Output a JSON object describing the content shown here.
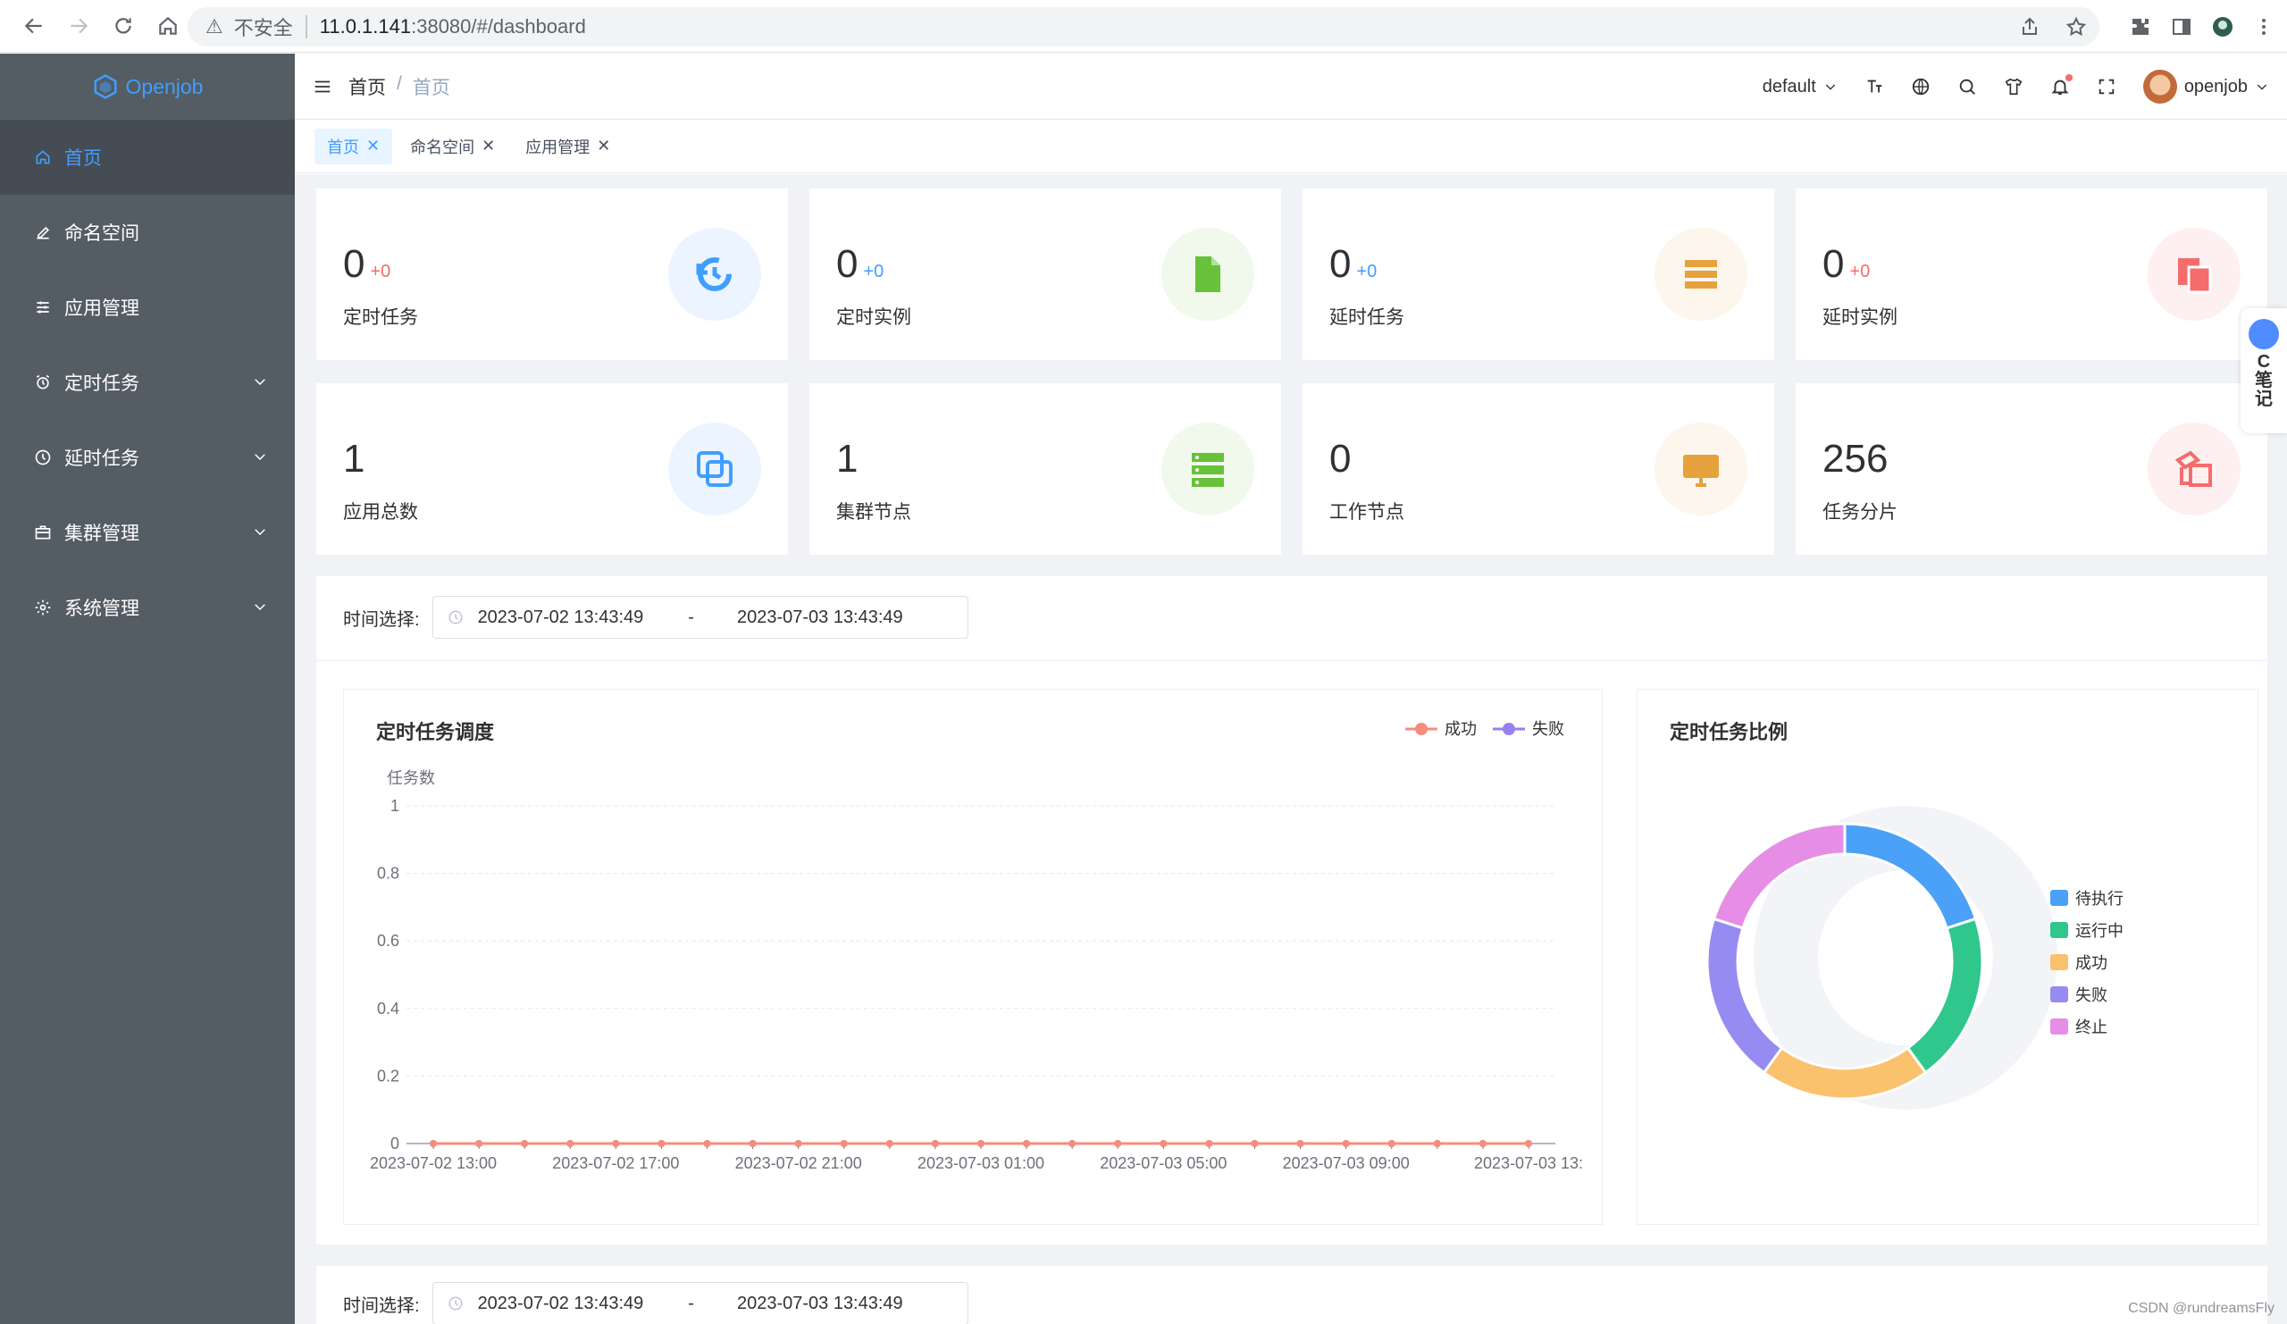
{
  "browser": {
    "insecure_label": "不安全",
    "url_host": "11.0.1.141",
    "url_rest": ":38080/#/dashboard"
  },
  "sidebar": {
    "logo_text": "Openjob",
    "items": [
      {
        "label": "首页",
        "icon": "home-icon",
        "active": true,
        "expandable": false
      },
      {
        "label": "命名空间",
        "icon": "edit-icon",
        "active": false,
        "expandable": false
      },
      {
        "label": "应用管理",
        "icon": "sliders-icon",
        "active": false,
        "expandable": false
      },
      {
        "label": "定时任务",
        "icon": "alarm-clock-icon",
        "active": false,
        "expandable": true
      },
      {
        "label": "延时任务",
        "icon": "clock-icon",
        "active": false,
        "expandable": true
      },
      {
        "label": "集群管理",
        "icon": "briefcase-icon",
        "active": false,
        "expandable": true
      },
      {
        "label": "系统管理",
        "icon": "gear-icon",
        "active": false,
        "expandable": true
      }
    ]
  },
  "header": {
    "breadcrumb": [
      "首页",
      "/",
      "首页"
    ],
    "namespace": "default",
    "username": "openjob"
  },
  "tags": [
    {
      "label": "首页",
      "active": true
    },
    {
      "label": "命名空间",
      "active": false
    },
    {
      "label": "应用管理",
      "active": false
    }
  ],
  "stats": [
    {
      "value": "0",
      "delta": "+0",
      "delta_color": "#f56c6c",
      "label": "定时任务",
      "icon": "history-icon",
      "color": "#409eff",
      "bg": "#ecf5ff"
    },
    {
      "value": "0",
      "delta": "+0",
      "delta_color": "#409eff",
      "label": "定时实例",
      "icon": "document-icon",
      "color": "#67c23a",
      "bg": "#f0f9eb"
    },
    {
      "value": "0",
      "delta": "+0",
      "delta_color": "#409eff",
      "label": "延时任务",
      "icon": "tray-icon",
      "color": "#e6a23c",
      "bg": "#fdf6ec"
    },
    {
      "value": "0",
      "delta": "+0",
      "delta_color": "#f56c6c",
      "label": "延时实例",
      "icon": "files-icon",
      "color": "#f56c6c",
      "bg": "#fef0f0"
    },
    {
      "value": "1",
      "delta": "",
      "delta_color": "",
      "label": "应用总数",
      "icon": "copy-icon",
      "color": "#409eff",
      "bg": "#ecf5ff"
    },
    {
      "value": "1",
      "delta": "",
      "delta_color": "",
      "label": "集群节点",
      "icon": "server-icon",
      "color": "#67c23a",
      "bg": "#f0f9eb"
    },
    {
      "value": "0",
      "delta": "",
      "delta_color": "",
      "label": "工作节点",
      "icon": "monitor-icon",
      "color": "#e6a23c",
      "bg": "#fdf6ec"
    },
    {
      "value": "256",
      "delta": "",
      "delta_color": "",
      "label": "任务分片",
      "icon": "shards-icon",
      "color": "#f56c6c",
      "bg": "#fef0f0"
    }
  ],
  "filter": {
    "label": "时间选择:",
    "start": "2023-07-02 13:43:49",
    "separator": "-",
    "end": "2023-07-03 13:43:49"
  },
  "filter2": {
    "label": "时间选择:",
    "start": "2023-07-02 13:43:49",
    "separator": "-",
    "end": "2023-07-03 13:43:49"
  },
  "chart_data": [
    {
      "type": "line",
      "title": "定时任务调度",
      "ylabel": "任务数",
      "ylim": [
        0,
        1
      ],
      "yticks": [
        "0",
        "0.2",
        "0.4",
        "0.6",
        "0.8",
        "1"
      ],
      "xtick_labels": [
        "2023-07-02 13:00",
        "2023-07-02 17:00",
        "2023-07-02 21:00",
        "2023-07-03 01:00",
        "2023-07-03 05:00",
        "2023-07-03 09:00",
        "2023-07-03 13:"
      ],
      "x": [
        "2023-07-02 13:00",
        "2023-07-02 14:00",
        "2023-07-02 15:00",
        "2023-07-02 16:00",
        "2023-07-02 17:00",
        "2023-07-02 18:00",
        "2023-07-02 19:00",
        "2023-07-02 20:00",
        "2023-07-02 21:00",
        "2023-07-02 22:00",
        "2023-07-02 23:00",
        "2023-07-03 00:00",
        "2023-07-03 01:00",
        "2023-07-03 02:00",
        "2023-07-03 03:00",
        "2023-07-03 04:00",
        "2023-07-03 05:00",
        "2023-07-03 06:00",
        "2023-07-03 07:00",
        "2023-07-03 08:00",
        "2023-07-03 09:00",
        "2023-07-03 10:00",
        "2023-07-03 11:00",
        "2023-07-03 12:00",
        "2023-07-03 13:00"
      ],
      "series": [
        {
          "name": "成功",
          "color": "#f58d7d",
          "values": [
            0,
            0,
            0,
            0,
            0,
            0,
            0,
            0,
            0,
            0,
            0,
            0,
            0,
            0,
            0,
            0,
            0,
            0,
            0,
            0,
            0,
            0,
            0,
            0,
            0
          ]
        },
        {
          "name": "失败",
          "color": "#9a7ff0",
          "values": [
            0,
            0,
            0,
            0,
            0,
            0,
            0,
            0,
            0,
            0,
            0,
            0,
            0,
            0,
            0,
            0,
            0,
            0,
            0,
            0,
            0,
            0,
            0,
            0,
            0
          ]
        }
      ],
      "legend": "top-right",
      "grid": true
    },
    {
      "type": "pie",
      "title": "定时任务比例",
      "slices": [
        {
          "name": "待执行",
          "color": "#4aa1f7",
          "value": 1
        },
        {
          "name": "运行中",
          "color": "#2fc78c",
          "value": 1
        },
        {
          "name": "成功",
          "color": "#fac26c",
          "value": 1
        },
        {
          "name": "失败",
          "color": "#968bf0",
          "value": 1
        },
        {
          "name": "终止",
          "color": "#e68ee6",
          "value": 1
        }
      ],
      "legend": "right"
    }
  ],
  "watermark": "CSDN @rundreamsFly",
  "side_float": {
    "label": "C\n笔\n记"
  }
}
